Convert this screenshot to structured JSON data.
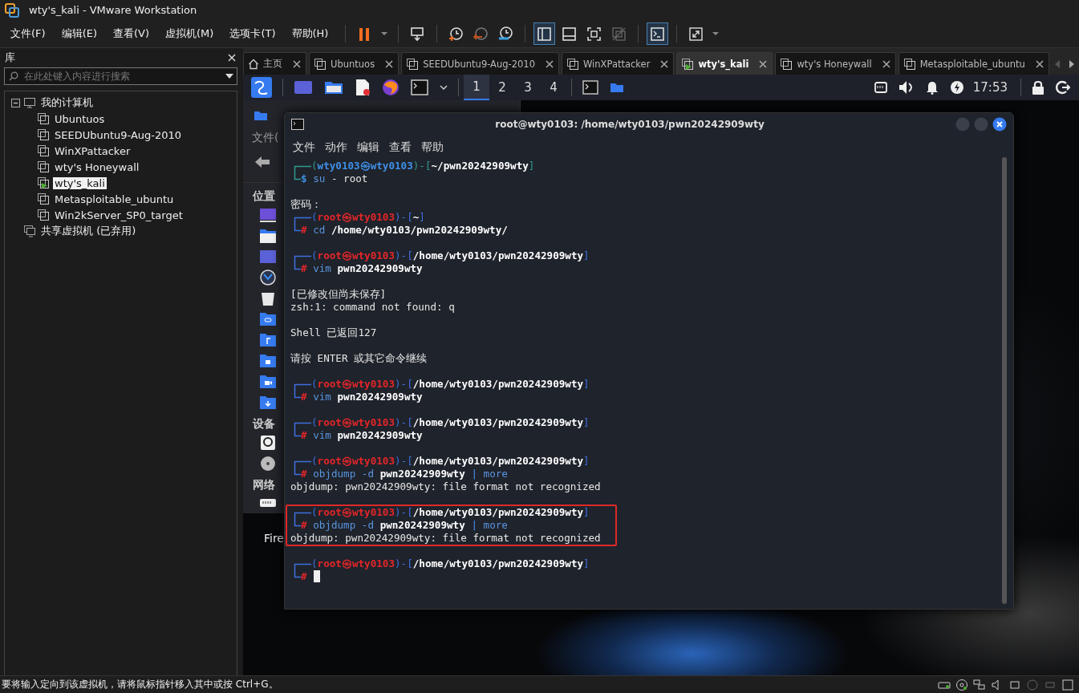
{
  "window": {
    "title": "wty's_kali - VMware Workstation"
  },
  "menu": [
    "文件(F)",
    "编辑(E)",
    "查看(V)",
    "虚拟机(M)",
    "选项卡(T)",
    "帮助(H)"
  ],
  "toolbar": [
    [
      {
        "kind": "pause",
        "selected": false,
        "disabled": false
      },
      {
        "kind": "dropdown",
        "selected": false,
        "disabled": false
      }
    ],
    [
      {
        "kind": "send-keys",
        "selected": false,
        "disabled": false
      }
    ],
    [
      {
        "kind": "snapshot",
        "selected": false,
        "disabled": false
      },
      {
        "kind": "revert",
        "selected": false,
        "disabled": false
      },
      {
        "kind": "snapshot-manager",
        "selected": false,
        "disabled": false
      }
    ],
    [
      {
        "kind": "library-view",
        "selected": true,
        "disabled": false
      },
      {
        "kind": "thumbnail-bar",
        "selected": false,
        "disabled": false
      },
      {
        "kind": "full-screen",
        "selected": false,
        "disabled": false
      },
      {
        "kind": "unity",
        "selected": false,
        "disabled": true
      }
    ],
    [
      {
        "kind": "console-view",
        "selected": true,
        "disabled": false
      }
    ],
    [
      {
        "kind": "stretch",
        "selected": false,
        "disabled": false
      },
      {
        "kind": "dropdown",
        "selected": false,
        "disabled": false
      }
    ]
  ],
  "library": {
    "title": "库",
    "search": {
      "placeholder": "在此处键入内容进行搜索"
    },
    "tree": [
      {
        "label": "我的计算机",
        "kind": "computer",
        "expanded": true,
        "children": [
          {
            "label": "Ubuntuos",
            "selected": false,
            "running": false
          },
          {
            "label": "SEEDUbuntu9-Aug-2010",
            "selected": false,
            "running": false
          },
          {
            "label": "WinXPattacker",
            "selected": false,
            "running": false
          },
          {
            "label": "wty's Honeywall",
            "selected": false,
            "running": false
          },
          {
            "label": "wty's_kali",
            "selected": true,
            "running": true
          },
          {
            "label": "Metasploitable_ubuntu",
            "selected": false,
            "running": false
          },
          {
            "label": "Win2kServer_SP0_target",
            "selected": false,
            "running": false
          }
        ]
      },
      {
        "label": "共享虚拟机 (已弃用)",
        "kind": "shared"
      }
    ]
  },
  "tabs": [
    {
      "label": "主页",
      "kind": "home",
      "selected": false
    },
    {
      "label": "Ubuntuos",
      "kind": "vm",
      "selected": false,
      "running": false
    },
    {
      "label": "SEEDUbuntu9-Aug-2010",
      "kind": "vm",
      "selected": false,
      "running": false
    },
    {
      "label": "WinXPattacker",
      "kind": "vm",
      "selected": false,
      "running": false
    },
    {
      "label": "wty's_kali",
      "kind": "vm",
      "selected": true,
      "running": true
    },
    {
      "label": "wty's Honeywall",
      "kind": "vm",
      "selected": false,
      "running": false
    },
    {
      "label": "Metasploitable_ubuntu",
      "kind": "vm",
      "selected": false,
      "running": false
    }
  ],
  "guest": {
    "panel": {
      "workspaces": [
        {
          "label": "1",
          "selected": true
        },
        {
          "label": "2",
          "selected": false
        },
        {
          "label": "3",
          "selected": false
        },
        {
          "label": "4",
          "selected": false
        }
      ],
      "clock": "17:53"
    },
    "file_manager": {
      "menu_label": "文件(",
      "sections": [
        "位置",
        "设备",
        "网络"
      ]
    },
    "desktop_label": "Fire",
    "terminal": {
      "title": "root@wty0103: /home/wty0103/pwn20242909wty",
      "menu": [
        "文件",
        "动作",
        "编辑",
        "查看",
        "帮助"
      ],
      "lines": [
        {
          "kind": "prompt",
          "highlighted": false,
          "privileged": false,
          "cursor": false,
          "open": "(",
          "user": "wty0103㉿wty0103",
          "mid": ")-[",
          "path": "~/pwn20242909wty",
          "close": "]",
          "sigil": "$",
          "tokens": [
            {
              "text": "su",
              "kind": "command"
            },
            {
              "text": "- root",
              "kind": "plain"
            }
          ]
        },
        {
          "kind": "blank",
          "highlighted": false
        },
        {
          "kind": "text",
          "highlighted": false,
          "text": "密码："
        },
        {
          "kind": "prompt",
          "highlighted": false,
          "privileged": true,
          "cursor": false,
          "open": "(",
          "user": "root㉿wty0103",
          "mid": ")-[",
          "path": "~",
          "close": "]",
          "sigil": "#",
          "tokens": [
            {
              "text": "cd",
              "kind": "command"
            },
            {
              "text": "/home/wty0103/pwn20242909wty/",
              "kind": "arg"
            }
          ]
        },
        {
          "kind": "blank",
          "highlighted": false
        },
        {
          "kind": "prompt",
          "highlighted": false,
          "privileged": true,
          "cursor": false,
          "open": "(",
          "user": "root㉿wty0103",
          "mid": ")-[",
          "path": "/home/wty0103/pwn20242909wty",
          "close": "]",
          "sigil": "#",
          "tokens": [
            {
              "text": "vim",
              "kind": "command"
            },
            {
              "text": "pwn20242909wty",
              "kind": "arg"
            }
          ]
        },
        {
          "kind": "blank",
          "highlighted": false
        },
        {
          "kind": "text",
          "highlighted": false,
          "text": "[已修改但尚未保存]"
        },
        {
          "kind": "text",
          "highlighted": false,
          "text": "zsh:1: command not found: q"
        },
        {
          "kind": "blank",
          "highlighted": false
        },
        {
          "kind": "text",
          "highlighted": false,
          "text": "Shell 已返回127"
        },
        {
          "kind": "blank",
          "highlighted": false
        },
        {
          "kind": "text",
          "highlighted": false,
          "text": "请按 ENTER 或其它命令继续"
        },
        {
          "kind": "blank",
          "highlighted": false
        },
        {
          "kind": "prompt",
          "highlighted": false,
          "privileged": true,
          "cursor": false,
          "open": "(",
          "user": "root㉿wty0103",
          "mid": ")-[",
          "path": "/home/wty0103/pwn20242909wty",
          "close": "]",
          "sigil": "#",
          "tokens": [
            {
              "text": "vim",
              "kind": "command"
            },
            {
              "text": "pwn20242909wty",
              "kind": "arg"
            }
          ]
        },
        {
          "kind": "blank",
          "highlighted": false
        },
        {
          "kind": "prompt",
          "highlighted": false,
          "privileged": true,
          "cursor": false,
          "open": "(",
          "user": "root㉿wty0103",
          "mid": ")-[",
          "path": "/home/wty0103/pwn20242909wty",
          "close": "]",
          "sigil": "#",
          "tokens": [
            {
              "text": "vim",
              "kind": "command"
            },
            {
              "text": "pwn20242909wty",
              "kind": "arg"
            }
          ]
        },
        {
          "kind": "blank",
          "highlighted": false
        },
        {
          "kind": "prompt",
          "highlighted": false,
          "privileged": true,
          "cursor": false,
          "open": "(",
          "user": "root㉿wty0103",
          "mid": ")-[",
          "path": "/home/wty0103/pwn20242909wty",
          "close": "]",
          "sigil": "#",
          "tokens": [
            {
              "text": "objdump",
              "kind": "command"
            },
            {
              "text": "-d",
              "kind": "option"
            },
            {
              "text": "pwn20242909wty",
              "kind": "arg"
            },
            {
              "text": "|",
              "kind": "operator"
            },
            {
              "text": "more",
              "kind": "command"
            }
          ]
        },
        {
          "kind": "text",
          "highlighted": false,
          "text": "objdump: pwn20242909wty: file format not recognized"
        },
        {
          "kind": "blank",
          "highlighted": false
        },
        {
          "kind": "prompt",
          "highlighted": true,
          "privileged": true,
          "cursor": false,
          "open": "(",
          "user": "root㉿wty0103",
          "mid": ")-[",
          "path": "/home/wty0103/pwn20242909wty",
          "close": "]",
          "sigil": "#",
          "tokens": [
            {
              "text": "objdump",
              "kind": "command"
            },
            {
              "text": "-d",
              "kind": "option"
            },
            {
              "text": "pwn20242909wty",
              "kind": "arg"
            },
            {
              "text": "|",
              "kind": "operator"
            },
            {
              "text": "more",
              "kind": "command"
            }
          ]
        },
        {
          "kind": "text",
          "highlighted": true,
          "text": "objdump: pwn20242909wty: file format not recognized"
        },
        {
          "kind": "blank",
          "highlighted": false
        },
        {
          "kind": "prompt",
          "highlighted": false,
          "privileged": true,
          "cursor": true,
          "open": "(",
          "user": "root㉿wty0103",
          "mid": ")-[",
          "path": "/home/wty0103/pwn20242909wty",
          "close": "]",
          "sigil": "#"
        }
      ]
    }
  },
  "status_bar": {
    "message": "要将输入定向到该虚拟机，请将鼠标指针移入其中或按 Ctrl+G。"
  }
}
